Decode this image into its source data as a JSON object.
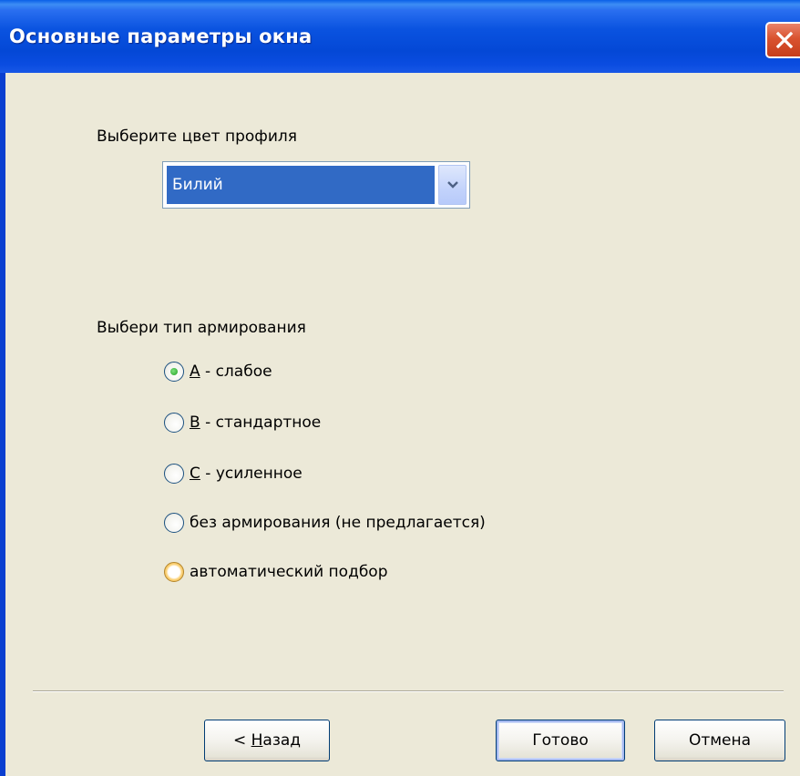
{
  "window": {
    "title": "Основные параметры окна",
    "close_icon": "close-icon"
  },
  "profile": {
    "label": "Выберите цвет профиля",
    "selected_value": "Билий",
    "dropdown_icon": "chevron-down-icon"
  },
  "reinforcement": {
    "label": "Выбери тип армирования",
    "options": [
      {
        "accel": "A",
        "rest": " - слабое",
        "checked": true
      },
      {
        "accel": "B",
        "rest": " - стандартное",
        "checked": false
      },
      {
        "accel": "C",
        "rest": " - усиленное",
        "checked": false
      },
      {
        "accel": "",
        "rest": "без армирования (не предлагается)",
        "checked": false
      },
      {
        "accel": "",
        "rest": "автоматический подбор",
        "checked": false
      }
    ]
  },
  "buttons": {
    "back_prefix": "< ",
    "back_accel": "Н",
    "back_rest": "азад",
    "finish_label": "Готово",
    "cancel_label": "Отмена"
  }
}
